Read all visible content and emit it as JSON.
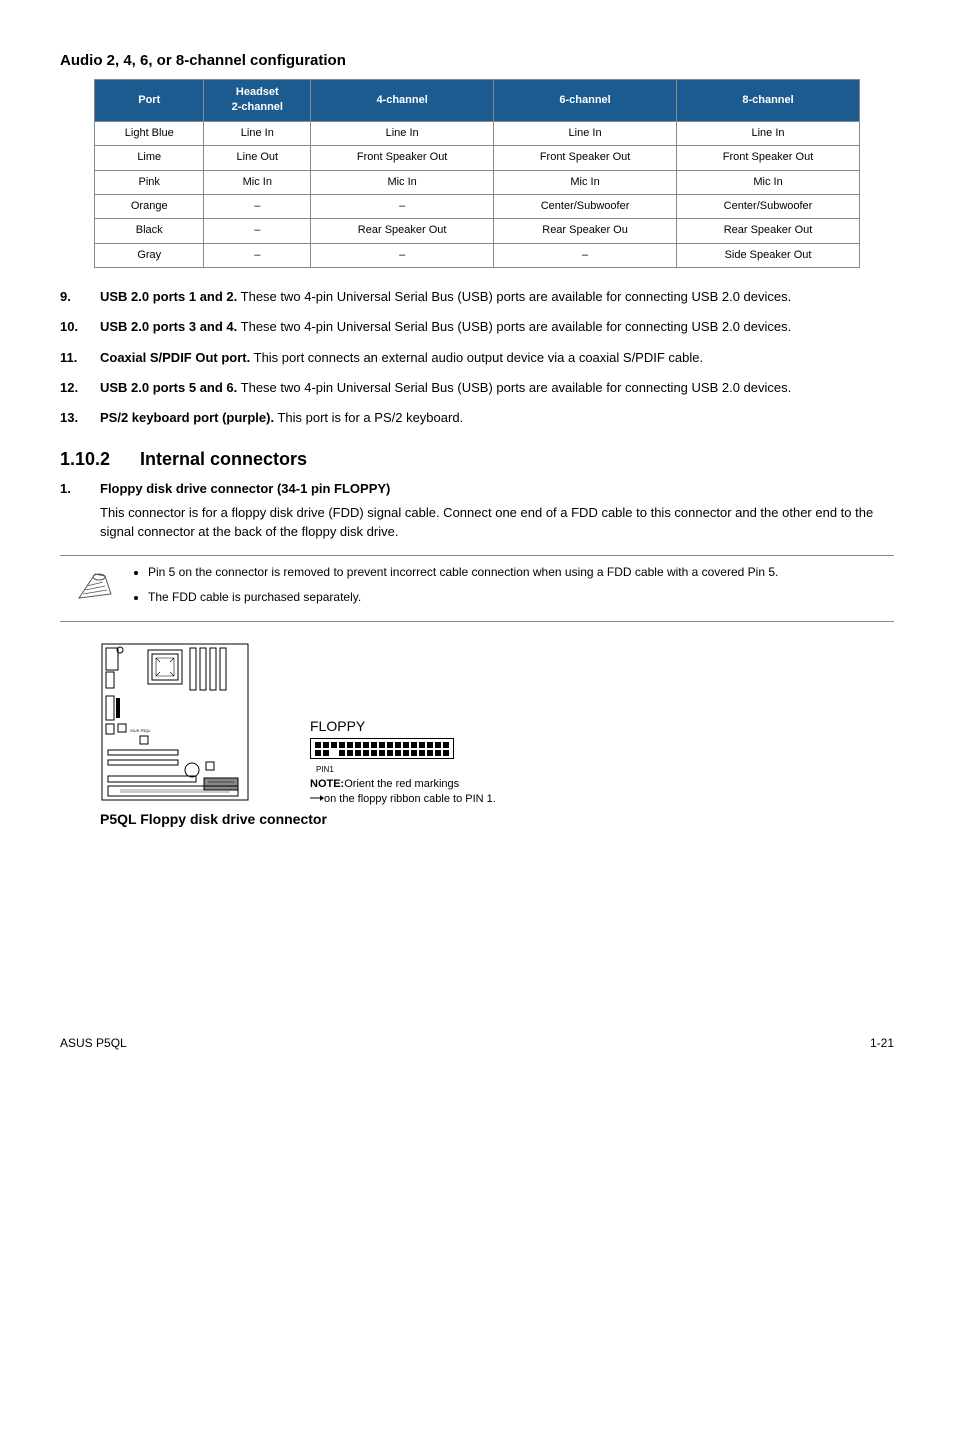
{
  "audio_heading": "Audio 2, 4, 6, or 8-channel configuration",
  "table": {
    "headers": [
      "Port",
      "Headset\n2-channel",
      "4-channel",
      "6-channel",
      "8-channel"
    ],
    "rows": [
      [
        "Light Blue",
        "Line In",
        "Line In",
        "Line In",
        "Line In"
      ],
      [
        "Lime",
        "Line Out",
        "Front Speaker Out",
        "Front Speaker Out",
        "Front Speaker Out"
      ],
      [
        "Pink",
        "Mic In",
        "Mic In",
        "Mic In",
        "Mic In"
      ],
      [
        "Orange",
        "–",
        "–",
        "Center/Subwoofer",
        "Center/Subwoofer"
      ],
      [
        "Black",
        "–",
        "Rear Speaker Out",
        "Rear Speaker Ou",
        "Rear Speaker Out"
      ],
      [
        "Gray",
        "–",
        "–",
        "–",
        "Side Speaker Out"
      ]
    ]
  },
  "list": [
    {
      "n": "9.",
      "bold": "USB 2.0 ports 1 and 2.",
      "text": " These two 4-pin Universal Serial Bus (USB) ports are available for connecting USB 2.0 devices."
    },
    {
      "n": "10.",
      "bold": "USB 2.0 ports 3 and 4.",
      "text": " These two 4-pin Universal Serial Bus (USB) ports are available for connecting USB 2.0 devices."
    },
    {
      "n": "11.",
      "bold": "Coaxial S/PDIF Out port.",
      "text": " This port connects an external audio output device via a coaxial S/PDIF cable."
    },
    {
      "n": "12.",
      "bold": "USB 2.0 ports 5 and 6.",
      "text": " These two 4-pin Universal Serial Bus (USB) ports are available for connecting USB 2.0 devices."
    },
    {
      "n": "13.",
      "bold": "PS/2 keyboard port (purple).",
      "text": " This port is for a PS/2 keyboard."
    }
  ],
  "subsection": {
    "idx": "1.10.2",
    "title": "Internal connectors"
  },
  "item1": {
    "n": "1.",
    "title": "Floppy disk drive connector (34-1 pin FLOPPY)",
    "para": "This connector is for a floppy disk drive (FDD) signal cable. Connect one end of a FDD cable to this connector and the other end to the signal connector at the back of the floppy disk drive."
  },
  "notes": [
    "Pin 5 on the connector is removed to prevent incorrect cable connection when using a FDD cable with a covered Pin 5.",
    "The FDD cable is purchased separately."
  ],
  "diagram": {
    "floppy_label": "FLOPPY",
    "pin1": "PIN1",
    "note_bold": "NOTE:",
    "note_line1": "Orient the red markings",
    "note_line2": "on the floppy ribbon cable to PIN 1.",
    "caption": "P5QL Floppy disk drive connector"
  },
  "footer": {
    "left": "ASUS P5QL",
    "right": "1-21"
  }
}
